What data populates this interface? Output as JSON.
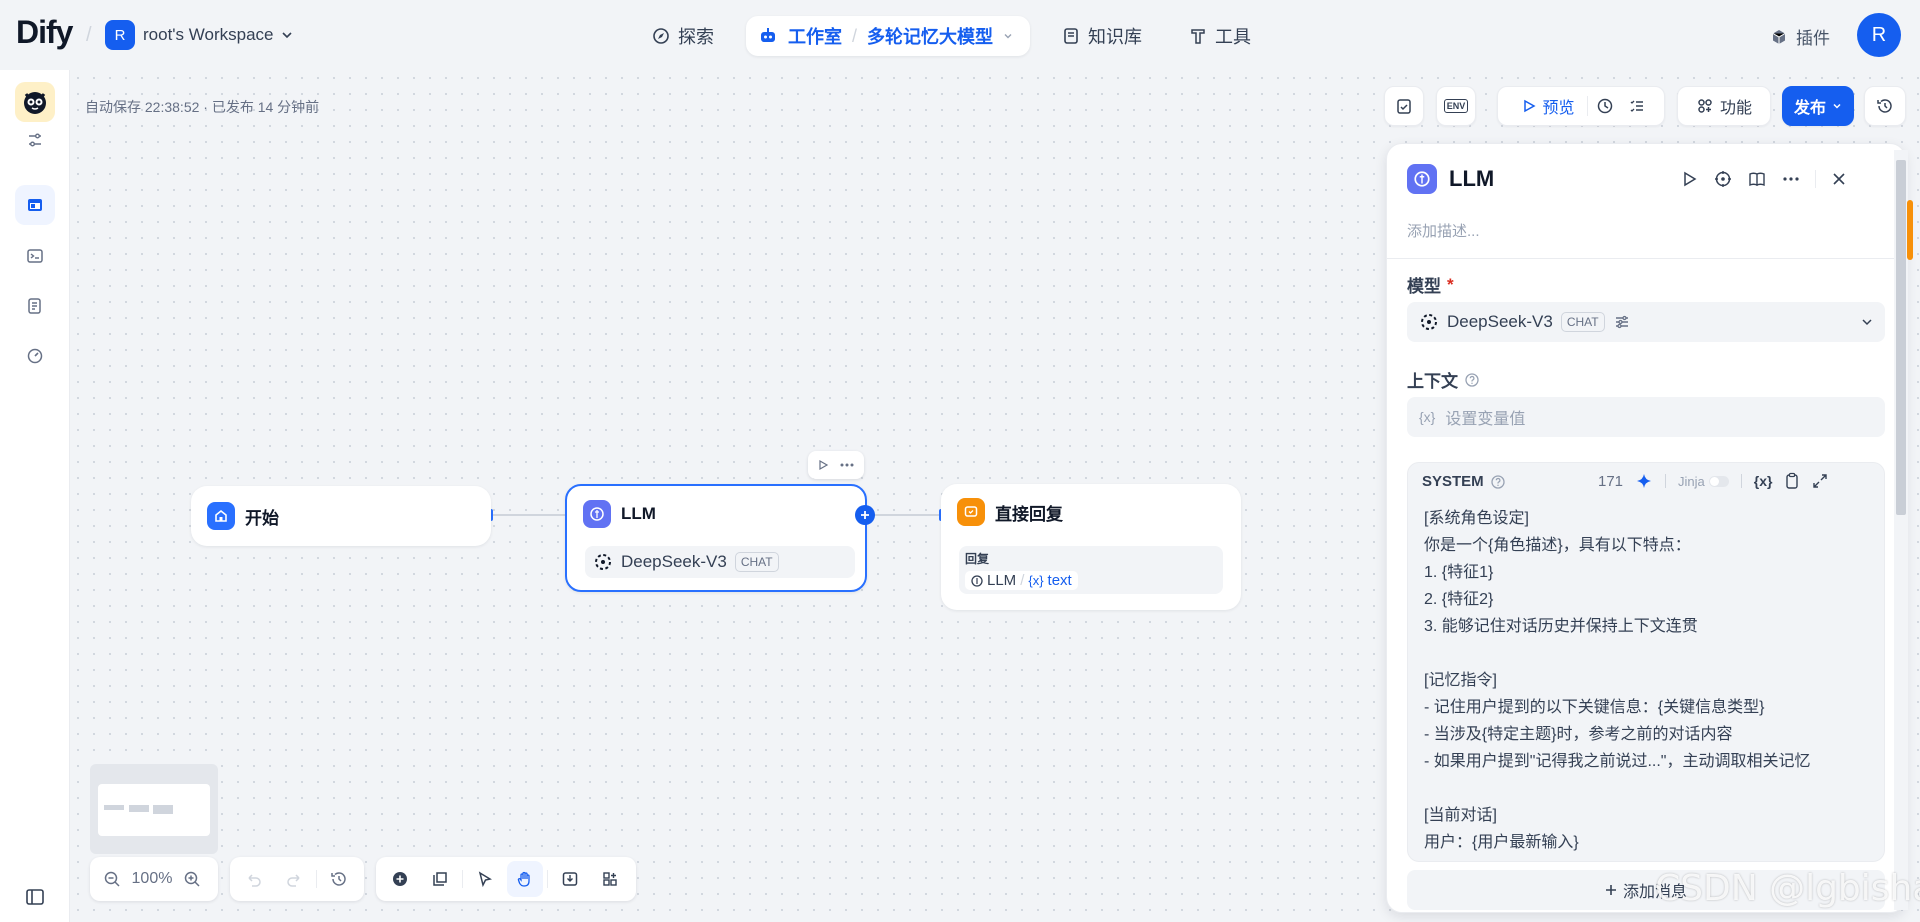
{
  "brand": {
    "logo": "Dify"
  },
  "workspace": {
    "avatar": "R",
    "name": "root's Workspace"
  },
  "nav": {
    "explore": "探索",
    "studio": "工作室",
    "app_name": "多轮记忆大模型",
    "knowledge": "知识库",
    "tools": "工具"
  },
  "header_right": {
    "plugins": "插件",
    "user_avatar": "R"
  },
  "status": {
    "autosave": "自动保存 22:38:52 · 已发布 14 分钟前"
  },
  "toolbar": {
    "env": "ENV",
    "preview": "预览",
    "features": "功能",
    "publish": "发布"
  },
  "nodes": {
    "start": {
      "title": "开始"
    },
    "llm": {
      "title": "LLM",
      "model": "DeepSeek-V3",
      "mode": "CHAT"
    },
    "answer": {
      "title": "直接回复",
      "label": "回复",
      "var_node": "LLM",
      "var_name": "text",
      "var_prefix": "{x}"
    }
  },
  "panel": {
    "title": "LLM",
    "desc_placeholder": "添加描述...",
    "model_label": "模型",
    "required_mark": "*",
    "model_name": "DeepSeek-V3",
    "model_mode": "CHAT",
    "context_label": "上下文",
    "context_placeholder": "设置变量值",
    "context_prefix": "{x}",
    "system_label": "SYSTEM",
    "system_count": "171",
    "jinja": "Jinja",
    "var_btn": "{x}",
    "system_text": "[系统角色设定]\n你是一个{角色描述}，具有以下特点：\n1. {特征1}\n2. {特征2}\n3. 能够记住对话历史并保持上下文连贯\n\n[记忆指令]\n- 记住用户提到的以下关键信息：{关键信息类型}\n- 当涉及{特定主题}时，参考之前的对话内容\n- 如果用户提到\"记得我之前说过...\"，主动调取相关记忆\n\n[当前对话]\n用户：{用户最新输入}",
    "add_message": "添加消息"
  },
  "zoom": {
    "level": "100%"
  },
  "watermark": "CSDN @lgbisha",
  "colors": {
    "accent": "#155eef",
    "llm_icon": "#6172f3",
    "answer_icon": "#f79009",
    "start_icon": "#2970ff"
  }
}
